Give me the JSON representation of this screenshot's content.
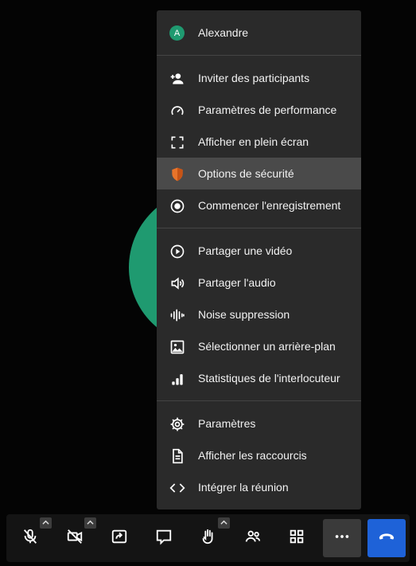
{
  "menu": {
    "user": {
      "initial": "A",
      "name": "Alexandre"
    },
    "items": [
      {
        "label": "Inviter des participants",
        "icon": "add-person-icon"
      },
      {
        "label": "Paramètres de performance",
        "icon": "gauge-icon"
      },
      {
        "label": "Afficher en plein écran",
        "icon": "fullscreen-icon"
      },
      {
        "label": "Options de sécurité",
        "icon": "shield-icon",
        "selected": true
      },
      {
        "label": "Commencer l'enregistrement",
        "icon": "record-icon"
      },
      {
        "label": "Partager une vidéo",
        "icon": "play-circle-icon"
      },
      {
        "label": "Partager l'audio",
        "icon": "speaker-icon"
      },
      {
        "label": "Noise suppression",
        "icon": "waveform-icon"
      },
      {
        "label": "Sélectionner un arrière-plan",
        "icon": "image-icon"
      },
      {
        "label": "Statistiques de l'interlocuteur",
        "icon": "signal-bars-icon"
      },
      {
        "label": "Paramètres",
        "icon": "gear-icon"
      },
      {
        "label": "Afficher les raccourcis",
        "icon": "document-icon"
      },
      {
        "label": "Intégrer la réunion",
        "icon": "code-icon"
      }
    ]
  },
  "toolbar": {
    "buttons": [
      "microphone-muted-icon",
      "camera-off-icon",
      "screen-share-icon",
      "chat-icon",
      "raise-hand-icon",
      "participants-icon",
      "tile-view-icon",
      "more-icon",
      "hangup-icon"
    ]
  },
  "colors": {
    "background": "#040404",
    "menu": "#2a2a2a",
    "menu_selected": "#4a4a4a",
    "avatar": "#1f9a70",
    "hangup": "#1e62d8",
    "shield": "#e8742a"
  }
}
